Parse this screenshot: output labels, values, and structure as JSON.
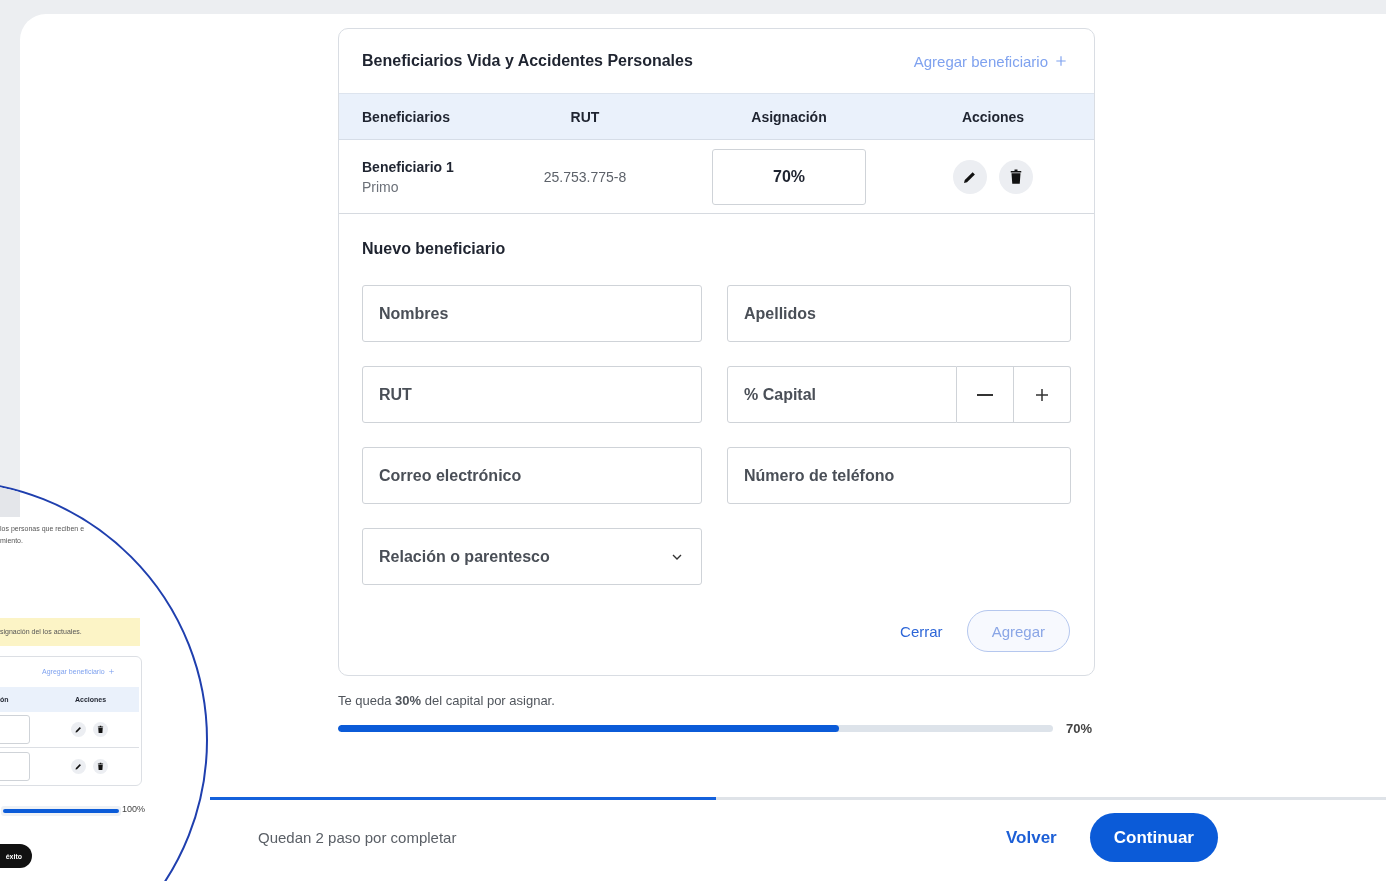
{
  "inset": {
    "description_lines": [
      "los personas que reciben e",
      "miento."
    ],
    "alert": "signación del los actuales.",
    "add_link": "Agregar beneficiario",
    "columns": [
      "ón",
      "Acciones"
    ],
    "progress": {
      "level": 1,
      "reading": "100%"
    },
    "button": "éxito"
  },
  "beneficiaries_card": {
    "title": "Beneficiarios Vida y Accidentes Personales",
    "add_link": "Agregar beneficiario",
    "columns": [
      "Beneficiarios",
      "RUT",
      "Asignación",
      "Acciones"
    ],
    "rows": [
      {
        "name": "Beneficiario 1",
        "relation": "Primo",
        "rut": "25.753.775-8",
        "allocation": "70%"
      }
    ]
  },
  "new_beneficiary": {
    "title": "Nuevo beneficiario",
    "fields": [
      {
        "kind": "text",
        "placeholder": "Nombres"
      },
      {
        "kind": "text",
        "placeholder": "Apellidos"
      },
      {
        "kind": "text",
        "placeholder": "RUT"
      },
      {
        "kind": "stepper",
        "placeholder": "% Capital"
      },
      {
        "kind": "text",
        "placeholder": "Correo electrónico"
      },
      {
        "kind": "text",
        "placeholder": "Número de teléfono"
      },
      {
        "kind": "select",
        "placeholder": "Relación o parentesco"
      }
    ],
    "buttons": [
      {
        "kind": "link",
        "label": "Cerrar",
        "disabled": false
      },
      {
        "kind": "outline",
        "label": "Agregar",
        "disabled": true
      }
    ]
  },
  "capital": {
    "message": "Te queda **30%** del capital por asignar.",
    "level": 0.7,
    "reading": "70%"
  },
  "steps": {
    "level": 0.43,
    "message": "Quedan 2 paso por completar",
    "back": "Volver",
    "continue": "Continuar"
  }
}
